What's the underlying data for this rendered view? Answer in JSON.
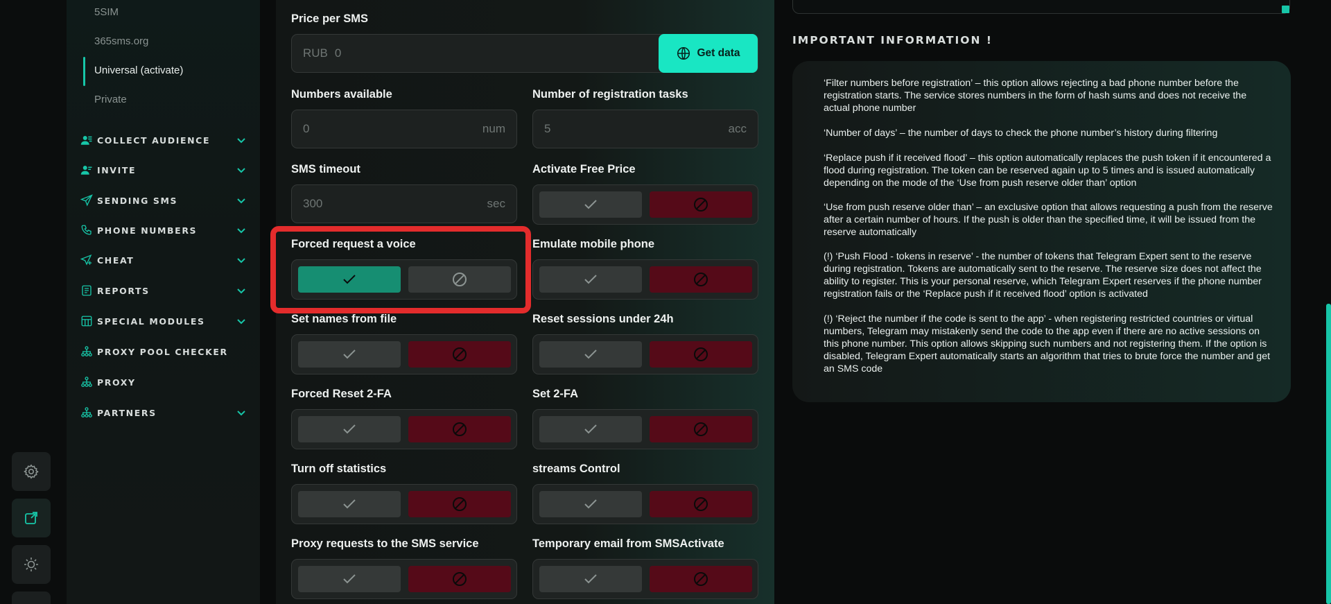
{
  "sidebar": {
    "sub_items": [
      {
        "label": "5SIM",
        "active": false
      },
      {
        "label": "365sms.org",
        "active": false
      },
      {
        "label": "Universal (activate)",
        "active": true
      },
      {
        "label": "Private",
        "active": false
      }
    ],
    "nav_items": [
      {
        "label": "COLLECT AUDIENCE",
        "icon": "user-group-icon",
        "has_chevron": true
      },
      {
        "label": "INVITE",
        "icon": "user-add-icon",
        "has_chevron": true
      },
      {
        "label": "SENDING SMS",
        "icon": "paper-plane-icon",
        "has_chevron": true
      },
      {
        "label": "PHONE NUMBERS",
        "icon": "phone-icon",
        "has_chevron": true
      },
      {
        "label": "CHEAT",
        "icon": "send-plus-icon",
        "has_chevron": true
      },
      {
        "label": "REPORTS",
        "icon": "report-icon",
        "has_chevron": true
      },
      {
        "label": "SPECIAL MODULES",
        "icon": "modules-icon",
        "has_chevron": true
      },
      {
        "label": "PROXY POOL CHECKER",
        "icon": "network-icon",
        "has_chevron": false
      },
      {
        "label": "PROXY",
        "icon": "network-icon",
        "has_chevron": false
      },
      {
        "label": "PARTNERS",
        "icon": "network-icon",
        "has_chevron": true
      }
    ]
  },
  "rail": {
    "icons": [
      "settings-gear-icon",
      "external-link-icon",
      "theme-sun-icon"
    ]
  },
  "form": {
    "price_label": "Price per SMS",
    "price_prefix": "RUB",
    "price_value": "0",
    "get_data_label": "Get data",
    "numbers_available_label": "Numbers available",
    "numbers_available_value": "0",
    "numbers_available_unit": "num",
    "reg_tasks_label": "Number of registration tasks",
    "reg_tasks_value": "5",
    "reg_tasks_unit": "acc",
    "sms_timeout_label": "SMS timeout",
    "sms_timeout_value": "300",
    "sms_timeout_unit": "sec",
    "toggles": [
      {
        "label": "Activate Free Price",
        "state": "off"
      },
      {
        "label": "Forced request a voice",
        "state": "on"
      },
      {
        "label": "Emulate mobile phone",
        "state": "off"
      },
      {
        "label": "Set names from file",
        "state": "off"
      },
      {
        "label": "Reset sessions under 24h",
        "state": "off"
      },
      {
        "label": "Forced Reset 2-FA",
        "state": "off"
      },
      {
        "label": "Set 2-FA",
        "state": "off"
      },
      {
        "label": "Turn off statistics",
        "state": "off"
      },
      {
        "label": "streams Control",
        "state": "off"
      },
      {
        "label": "Proxy requests to the SMS service",
        "state": "off"
      },
      {
        "label": "Temporary email from SMSActivate",
        "state": "off"
      }
    ]
  },
  "info": {
    "title": "IMPORTANT INFORMATION !",
    "paragraphs": [
      "‘Filter numbers before registration’ – this option allows rejecting a bad phone number before the registration starts. The service stores numbers in the form of hash sums and does not receive the actual phone number",
      "‘Number of days’ – the number of days to check the phone number’s history during filtering",
      "‘Replace push if it received flood’ – this option automatically replaces the push token if it encountered a flood during registration. The token can be reserved again up to 5 times and is issued automatically depending on the mode of the ‘Use from push reserve older than’ option",
      "‘Use from push reserve older than’ – an exclusive option that allows requesting a push from the reserve after a certain number of hours. If the push is older than the specified time, it will be issued from the reserve automatically",
      "(!) ‘Push Flood - tokens in reserve’ - the number of tokens that Telegram Expert sent to the reserve during registration. Tokens are automatically sent to the reserve. The reserve size does not affect the ability to register. This is your personal reserve, which Telegram Expert reserves if the phone number registration fails or the ‘Replace push if it received flood’ option is activated",
      "(!) ‘Reject the number if the code is sent to the app’ - when registering restricted countries or virtual numbers, Telegram may mistakenly send the code to the app even if there are no active sessions on this phone number. This option allows skipping such numbers and not registering them. If the option is disabled, Telegram Expert automatically starts an algorithm that tries to brute force the number and get an SMS code"
    ]
  },
  "colors": {
    "accent": "#19e6c3",
    "toggle_on": "#168e72",
    "toggle_off_red": "#550a18",
    "highlight": "#e32c2c"
  }
}
